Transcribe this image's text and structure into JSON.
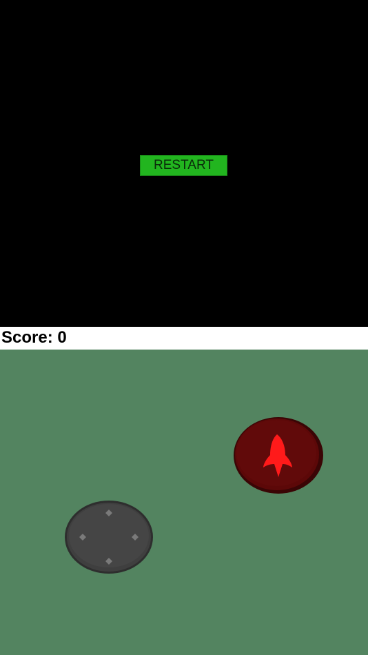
{
  "game": {
    "restart_label": "RESTART",
    "score_text": "Score: 0",
    "score": 0
  },
  "colors": {
    "game_background": "#000000",
    "restart_button": "#22b51f",
    "score_bar": "#ffffff",
    "controls_background": "#538460",
    "joystick": "#3d3d3d",
    "fire_button": "#5a0a0a",
    "fire_icon": "#ff1a1a"
  },
  "icons": {
    "joystick": "joystick-icon",
    "fire": "rocket-icon"
  }
}
